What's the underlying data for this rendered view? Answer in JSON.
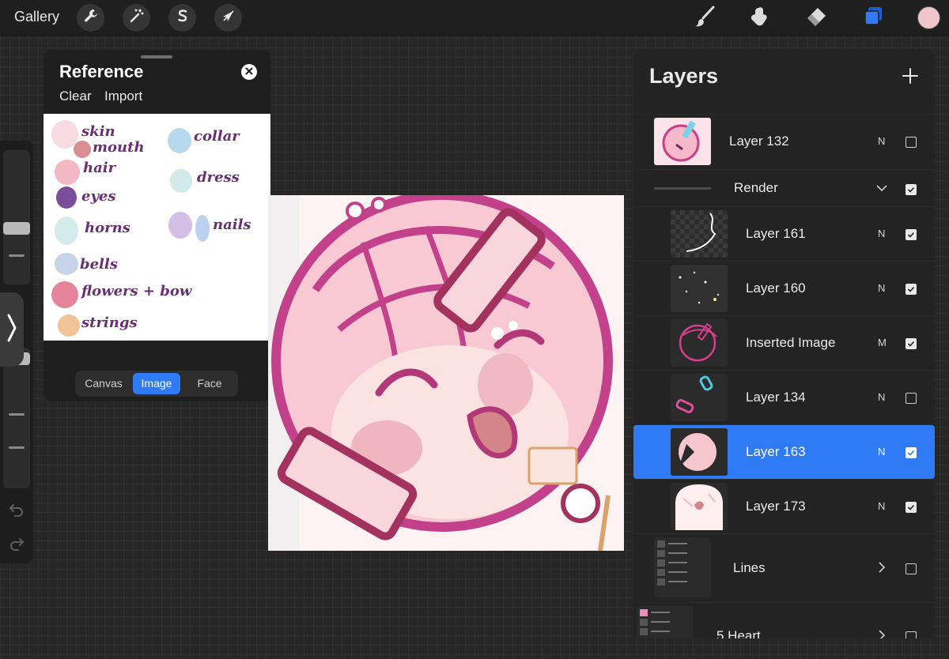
{
  "toolbar": {
    "gallery_label": "Gallery",
    "actions_icon": "wrench-icon",
    "adjustments_icon": "magic-wand-icon",
    "selection_icon": "selection-s-icon",
    "transform_icon": "arrow-cursor-icon",
    "brush_icon": "brush-icon",
    "smudge_icon": "smudge-icon",
    "eraser_icon": "eraser-icon",
    "layers_icon": "layers-icon",
    "current_color": "#f1c5cc",
    "accent_color": "#2f7bf6"
  },
  "reference": {
    "title": "Reference",
    "clear_label": "Clear",
    "import_label": "Import",
    "image_labels": {
      "skin": "skin",
      "mouth": "mouth",
      "hair": "hair",
      "eyes": "eyes",
      "horns": "horns",
      "bells": "bells",
      "flowers": "flowers + bow",
      "strings": "strings",
      "collar": "collar",
      "dress": "dress",
      "nails": "nails"
    },
    "tabs": [
      {
        "label": "Canvas",
        "active": false
      },
      {
        "label": "Image",
        "active": true
      },
      {
        "label": "Face",
        "active": false
      }
    ]
  },
  "layers": {
    "title": "Layers",
    "items": [
      {
        "name": "Layer 132",
        "mode": "N",
        "visible": false,
        "indent": false,
        "type": "layer"
      },
      {
        "name": "Render",
        "mode": "",
        "visible": true,
        "indent": false,
        "type": "group-open"
      },
      {
        "name": "Layer 161",
        "mode": "N",
        "visible": true,
        "indent": true,
        "type": "layer"
      },
      {
        "name": "Layer 160",
        "mode": "N",
        "visible": true,
        "indent": true,
        "type": "layer"
      },
      {
        "name": "Inserted Image",
        "mode": "M",
        "visible": true,
        "indent": true,
        "type": "layer"
      },
      {
        "name": "Layer 134",
        "mode": "N",
        "visible": false,
        "indent": true,
        "type": "layer"
      },
      {
        "name": "Layer 163",
        "mode": "N",
        "visible": true,
        "indent": true,
        "type": "layer",
        "selected": true
      },
      {
        "name": "Layer 173",
        "mode": "N",
        "visible": true,
        "indent": true,
        "type": "layer"
      },
      {
        "name": "Lines",
        "mode": "",
        "visible": false,
        "indent": false,
        "type": "group-closed"
      },
      {
        "name": "5 Heart",
        "mode": "",
        "visible": false,
        "indent": false,
        "type": "group-closed"
      }
    ]
  }
}
